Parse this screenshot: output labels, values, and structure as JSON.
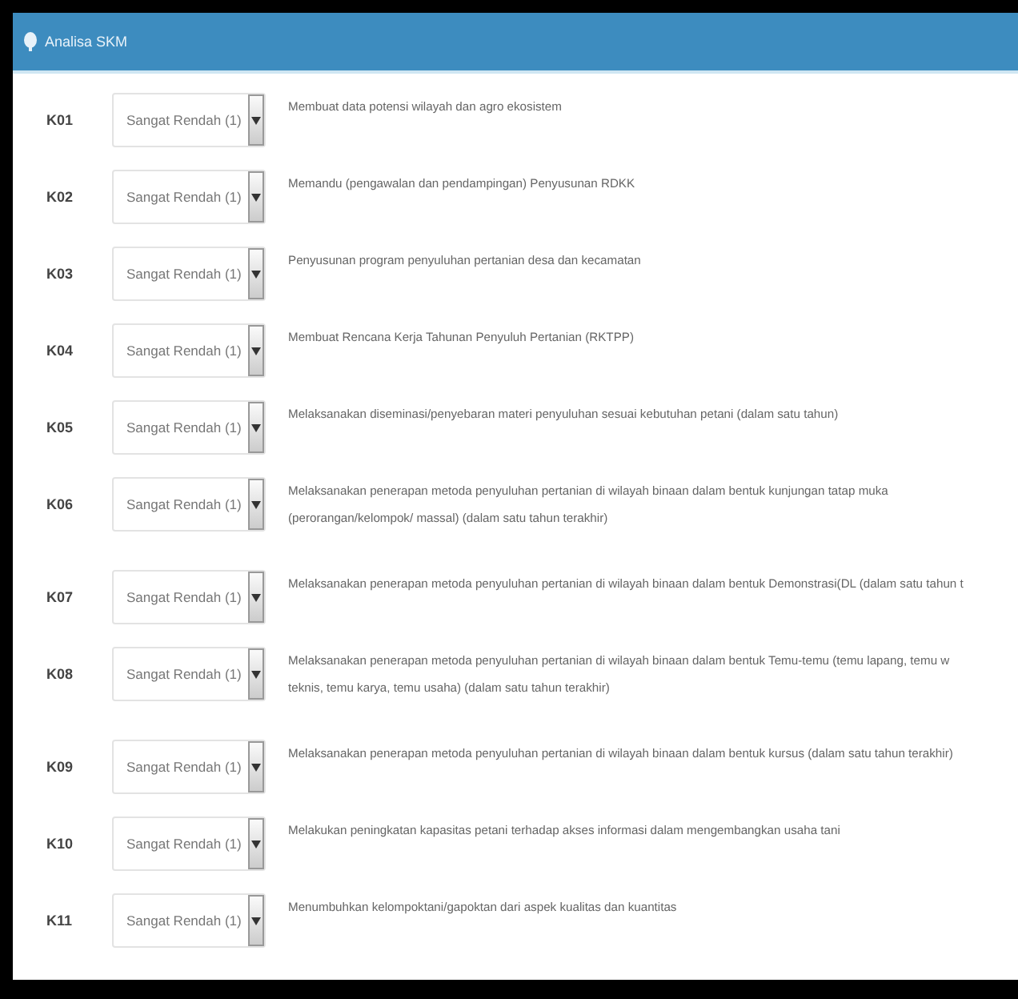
{
  "header": {
    "title": "Analisa SKM"
  },
  "rows": [
    {
      "code": "K01",
      "value": "Sangat Rendah (1)",
      "lines": [
        "Membuat data potensi wilayah dan agro ekosistem"
      ]
    },
    {
      "code": "K02",
      "value": "Sangat Rendah (1)",
      "lines": [
        "Memandu (pengawalan dan pendampingan) Penyusunan RDKK"
      ]
    },
    {
      "code": "K03",
      "value": "Sangat Rendah (1)",
      "lines": [
        "Penyusunan program penyuluhan pertanian desa dan kecamatan"
      ]
    },
    {
      "code": "K04",
      "value": "Sangat Rendah (1)",
      "lines": [
        "Membuat Rencana Kerja Tahunan Penyuluh Pertanian (RKTPP)"
      ]
    },
    {
      "code": "K05",
      "value": "Sangat Rendah (1)",
      "lines": [
        "Melaksanakan diseminasi/penyebaran materi penyuluhan sesuai kebutuhan petani (dalam satu tahun)"
      ]
    },
    {
      "code": "K06",
      "value": "Sangat Rendah (1)",
      "lines": [
        "Melaksanakan penerapan metoda penyuluhan pertanian di wilayah binaan dalam bentuk kunjungan tatap muka",
        "(perorangan/kelompok/ massal) (dalam satu tahun terakhir)"
      ]
    },
    {
      "code": "K07",
      "value": "Sangat Rendah (1)",
      "lines": [
        "Melaksanakan penerapan metoda penyuluhan pertanian di wilayah binaan dalam bentuk Demonstrasi(DL (dalam satu tahun t"
      ]
    },
    {
      "code": "K08",
      "value": "Sangat Rendah (1)",
      "lines": [
        "Melaksanakan penerapan metoda penyuluhan pertanian di wilayah binaan dalam bentuk Temu-temu (temu lapang, temu w",
        "teknis, temu karya, temu usaha) (dalam satu tahun terakhir)"
      ]
    },
    {
      "code": "K09",
      "value": "Sangat Rendah (1)",
      "lines": [
        "Melaksanakan penerapan metoda penyuluhan pertanian di wilayah binaan dalam bentuk kursus (dalam satu tahun terakhir)"
      ]
    },
    {
      "code": "K10",
      "value": "Sangat Rendah (1)",
      "lines": [
        "Melakukan peningkatan kapasitas petani terhadap akses informasi dalam mengembangkan usaha tani"
      ]
    },
    {
      "code": "K11",
      "value": "Sangat Rendah (1)",
      "lines": [
        "Menumbuhkan kelompoktani/gapoktan dari aspek kualitas dan kuantitas"
      ]
    }
  ]
}
